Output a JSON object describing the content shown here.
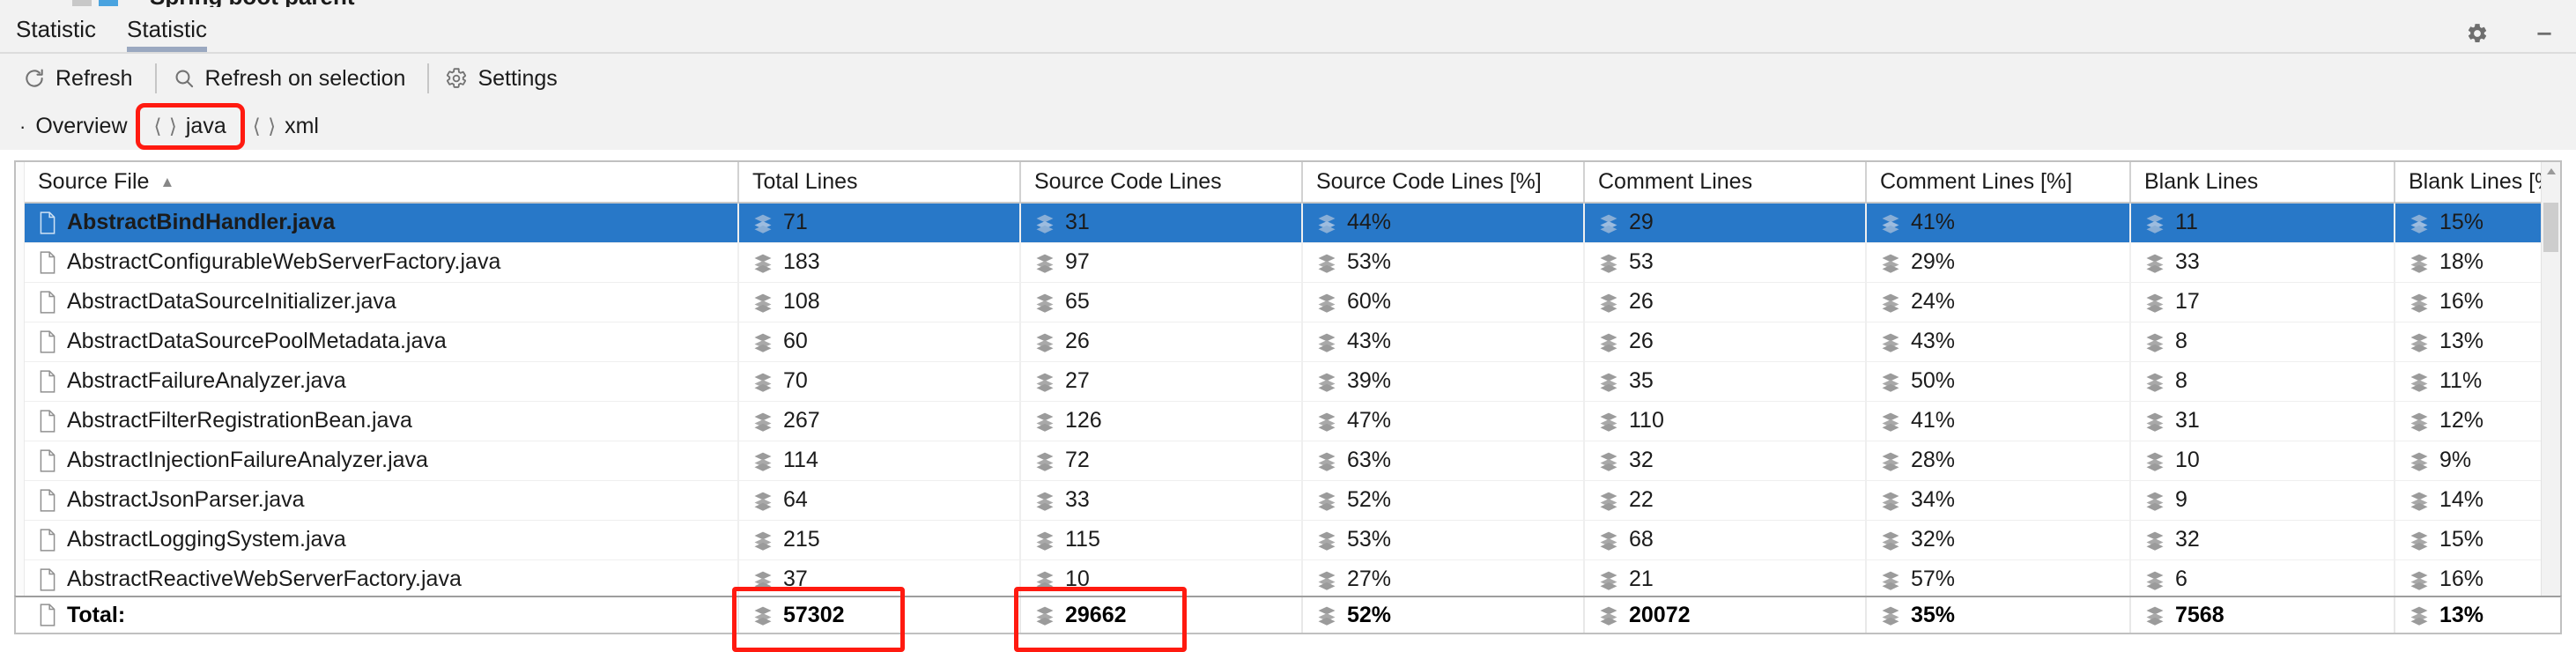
{
  "window": {
    "cut_title": "Spring boot parent",
    "gear_icon": "gear-icon",
    "minimize_icon": "minimize-icon"
  },
  "tabs": [
    {
      "label": "Statistic",
      "active": false
    },
    {
      "label": "Statistic",
      "active": true
    }
  ],
  "toolbar": {
    "items": [
      {
        "label": "Refresh",
        "icon": "refresh-icon"
      },
      {
        "label": "Refresh on selection",
        "icon": "search-icon"
      },
      {
        "label": "Settings",
        "icon": "gear-icon"
      }
    ]
  },
  "breadcrumbs": [
    {
      "label": "Overview",
      "icon": "dot-icon",
      "highlighted": false
    },
    {
      "label": "java",
      "icon": "code-brackets-icon",
      "highlighted": true
    },
    {
      "label": "xml",
      "icon": "code-brackets-icon",
      "highlighted": false
    }
  ],
  "table": {
    "sort_column": "Source File",
    "sort_direction": "ascending",
    "columns": [
      "Source File",
      "Total Lines",
      "Source Code Lines",
      "Source Code Lines [%]",
      "Comment Lines",
      "Comment Lines [%]",
      "Blank Lines",
      "Blank Lines [%]"
    ],
    "rows": [
      {
        "selected": true,
        "name": "AbstractBindHandler.java",
        "total_lines": "71",
        "source_code_lines": "31",
        "source_code_lines_pct": "44%",
        "comment_lines": "29",
        "comment_lines_pct": "41%",
        "blank_lines": "11",
        "blank_lines_pct": "15%"
      },
      {
        "selected": false,
        "name": "AbstractConfigurableWebServerFactory.java",
        "total_lines": "183",
        "source_code_lines": "97",
        "source_code_lines_pct": "53%",
        "comment_lines": "53",
        "comment_lines_pct": "29%",
        "blank_lines": "33",
        "blank_lines_pct": "18%"
      },
      {
        "selected": false,
        "name": "AbstractDataSourceInitializer.java",
        "total_lines": "108",
        "source_code_lines": "65",
        "source_code_lines_pct": "60%",
        "comment_lines": "26",
        "comment_lines_pct": "24%",
        "blank_lines": "17",
        "blank_lines_pct": "16%"
      },
      {
        "selected": false,
        "name": "AbstractDataSourcePoolMetadata.java",
        "total_lines": "60",
        "source_code_lines": "26",
        "source_code_lines_pct": "43%",
        "comment_lines": "26",
        "comment_lines_pct": "43%",
        "blank_lines": "8",
        "blank_lines_pct": "13%"
      },
      {
        "selected": false,
        "name": "AbstractFailureAnalyzer.java",
        "total_lines": "70",
        "source_code_lines": "27",
        "source_code_lines_pct": "39%",
        "comment_lines": "35",
        "comment_lines_pct": "50%",
        "blank_lines": "8",
        "blank_lines_pct": "11%"
      },
      {
        "selected": false,
        "name": "AbstractFilterRegistrationBean.java",
        "total_lines": "267",
        "source_code_lines": "126",
        "source_code_lines_pct": "47%",
        "comment_lines": "110",
        "comment_lines_pct": "41%",
        "blank_lines": "31",
        "blank_lines_pct": "12%"
      },
      {
        "selected": false,
        "name": "AbstractInjectionFailureAnalyzer.java",
        "total_lines": "114",
        "source_code_lines": "72",
        "source_code_lines_pct": "63%",
        "comment_lines": "32",
        "comment_lines_pct": "28%",
        "blank_lines": "10",
        "blank_lines_pct": "9%"
      },
      {
        "selected": false,
        "name": "AbstractJsonParser.java",
        "total_lines": "64",
        "source_code_lines": "33",
        "source_code_lines_pct": "52%",
        "comment_lines": "22",
        "comment_lines_pct": "34%",
        "blank_lines": "9",
        "blank_lines_pct": "14%"
      },
      {
        "selected": false,
        "name": "AbstractLoggingSystem.java",
        "total_lines": "215",
        "source_code_lines": "115",
        "source_code_lines_pct": "53%",
        "comment_lines": "68",
        "comment_lines_pct": "32%",
        "blank_lines": "32",
        "blank_lines_pct": "15%"
      },
      {
        "selected": false,
        "name": "AbstractReactiveWebServerFactory.java",
        "total_lines": "37",
        "source_code_lines": "10",
        "source_code_lines_pct": "27%",
        "comment_lines": "21",
        "comment_lines_pct": "57%",
        "blank_lines": "6",
        "blank_lines_pct": "16%"
      }
    ],
    "totals": {
      "name": "Total:",
      "total_lines": "57302",
      "source_code_lines": "29662",
      "source_code_lines_pct": "52%",
      "comment_lines": "20072",
      "comment_lines_pct": "35%",
      "blank_lines": "7568",
      "blank_lines_pct": "13%"
    }
  },
  "annotations": {
    "highlight_color": "#ff1a10",
    "highlighted_items": [
      "java",
      "57302",
      "29662"
    ]
  },
  "colors": {
    "selection_blue": "#2878c8",
    "chrome_gray": "#f2f2f2",
    "tab_underline": "#9aa8c0"
  }
}
